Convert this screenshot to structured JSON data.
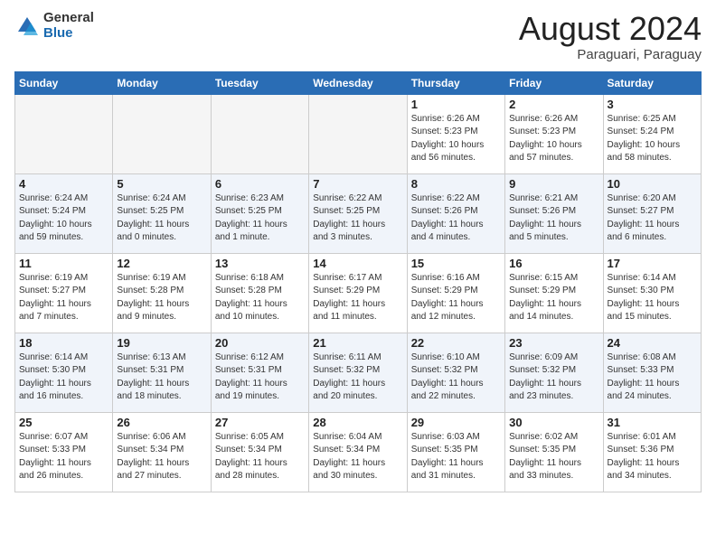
{
  "header": {
    "logo_general": "General",
    "logo_blue": "Blue",
    "month_title": "August 2024",
    "location": "Paraguari, Paraguay"
  },
  "days_of_week": [
    "Sunday",
    "Monday",
    "Tuesday",
    "Wednesday",
    "Thursday",
    "Friday",
    "Saturday"
  ],
  "weeks": [
    [
      {
        "day": "",
        "info": "",
        "empty": true
      },
      {
        "day": "",
        "info": "",
        "empty": true
      },
      {
        "day": "",
        "info": "",
        "empty": true
      },
      {
        "day": "",
        "info": "",
        "empty": true
      },
      {
        "day": "1",
        "info": "Sunrise: 6:26 AM\nSunset: 5:23 PM\nDaylight: 10 hours\nand 56 minutes."
      },
      {
        "day": "2",
        "info": "Sunrise: 6:26 AM\nSunset: 5:23 PM\nDaylight: 10 hours\nand 57 minutes."
      },
      {
        "day": "3",
        "info": "Sunrise: 6:25 AM\nSunset: 5:24 PM\nDaylight: 10 hours\nand 58 minutes."
      }
    ],
    [
      {
        "day": "4",
        "info": "Sunrise: 6:24 AM\nSunset: 5:24 PM\nDaylight: 10 hours\nand 59 minutes."
      },
      {
        "day": "5",
        "info": "Sunrise: 6:24 AM\nSunset: 5:25 PM\nDaylight: 11 hours\nand 0 minutes."
      },
      {
        "day": "6",
        "info": "Sunrise: 6:23 AM\nSunset: 5:25 PM\nDaylight: 11 hours\nand 1 minute."
      },
      {
        "day": "7",
        "info": "Sunrise: 6:22 AM\nSunset: 5:25 PM\nDaylight: 11 hours\nand 3 minutes."
      },
      {
        "day": "8",
        "info": "Sunrise: 6:22 AM\nSunset: 5:26 PM\nDaylight: 11 hours\nand 4 minutes."
      },
      {
        "day": "9",
        "info": "Sunrise: 6:21 AM\nSunset: 5:26 PM\nDaylight: 11 hours\nand 5 minutes."
      },
      {
        "day": "10",
        "info": "Sunrise: 6:20 AM\nSunset: 5:27 PM\nDaylight: 11 hours\nand 6 minutes."
      }
    ],
    [
      {
        "day": "11",
        "info": "Sunrise: 6:19 AM\nSunset: 5:27 PM\nDaylight: 11 hours\nand 7 minutes."
      },
      {
        "day": "12",
        "info": "Sunrise: 6:19 AM\nSunset: 5:28 PM\nDaylight: 11 hours\nand 9 minutes."
      },
      {
        "day": "13",
        "info": "Sunrise: 6:18 AM\nSunset: 5:28 PM\nDaylight: 11 hours\nand 10 minutes."
      },
      {
        "day": "14",
        "info": "Sunrise: 6:17 AM\nSunset: 5:29 PM\nDaylight: 11 hours\nand 11 minutes."
      },
      {
        "day": "15",
        "info": "Sunrise: 6:16 AM\nSunset: 5:29 PM\nDaylight: 11 hours\nand 12 minutes."
      },
      {
        "day": "16",
        "info": "Sunrise: 6:15 AM\nSunset: 5:29 PM\nDaylight: 11 hours\nand 14 minutes."
      },
      {
        "day": "17",
        "info": "Sunrise: 6:14 AM\nSunset: 5:30 PM\nDaylight: 11 hours\nand 15 minutes."
      }
    ],
    [
      {
        "day": "18",
        "info": "Sunrise: 6:14 AM\nSunset: 5:30 PM\nDaylight: 11 hours\nand 16 minutes."
      },
      {
        "day": "19",
        "info": "Sunrise: 6:13 AM\nSunset: 5:31 PM\nDaylight: 11 hours\nand 18 minutes."
      },
      {
        "day": "20",
        "info": "Sunrise: 6:12 AM\nSunset: 5:31 PM\nDaylight: 11 hours\nand 19 minutes."
      },
      {
        "day": "21",
        "info": "Sunrise: 6:11 AM\nSunset: 5:32 PM\nDaylight: 11 hours\nand 20 minutes."
      },
      {
        "day": "22",
        "info": "Sunrise: 6:10 AM\nSunset: 5:32 PM\nDaylight: 11 hours\nand 22 minutes."
      },
      {
        "day": "23",
        "info": "Sunrise: 6:09 AM\nSunset: 5:32 PM\nDaylight: 11 hours\nand 23 minutes."
      },
      {
        "day": "24",
        "info": "Sunrise: 6:08 AM\nSunset: 5:33 PM\nDaylight: 11 hours\nand 24 minutes."
      }
    ],
    [
      {
        "day": "25",
        "info": "Sunrise: 6:07 AM\nSunset: 5:33 PM\nDaylight: 11 hours\nand 26 minutes."
      },
      {
        "day": "26",
        "info": "Sunrise: 6:06 AM\nSunset: 5:34 PM\nDaylight: 11 hours\nand 27 minutes."
      },
      {
        "day": "27",
        "info": "Sunrise: 6:05 AM\nSunset: 5:34 PM\nDaylight: 11 hours\nand 28 minutes."
      },
      {
        "day": "28",
        "info": "Sunrise: 6:04 AM\nSunset: 5:34 PM\nDaylight: 11 hours\nand 30 minutes."
      },
      {
        "day": "29",
        "info": "Sunrise: 6:03 AM\nSunset: 5:35 PM\nDaylight: 11 hours\nand 31 minutes."
      },
      {
        "day": "30",
        "info": "Sunrise: 6:02 AM\nSunset: 5:35 PM\nDaylight: 11 hours\nand 33 minutes."
      },
      {
        "day": "31",
        "info": "Sunrise: 6:01 AM\nSunset: 5:36 PM\nDaylight: 11 hours\nand 34 minutes."
      }
    ]
  ]
}
